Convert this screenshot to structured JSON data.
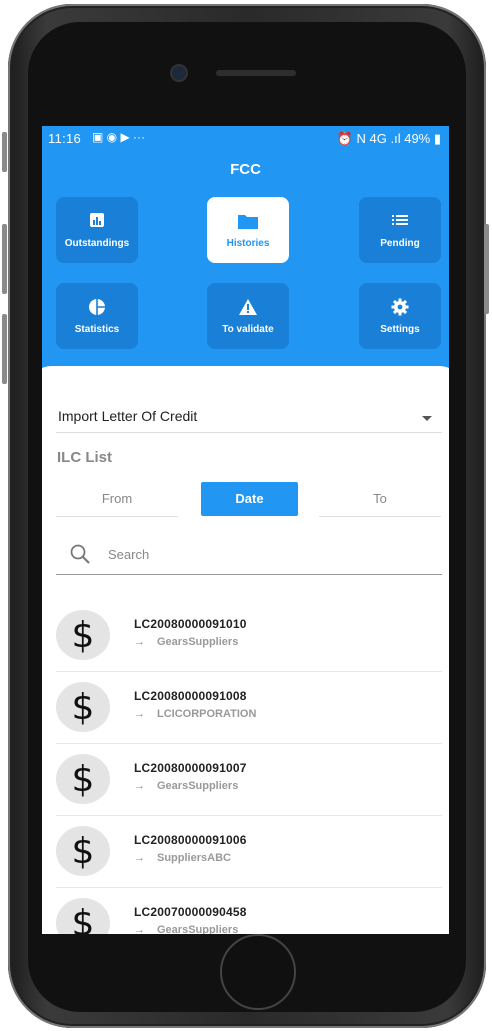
{
  "status_bar": {
    "time": "11:16",
    "left_icons": "▣ ◉ ▶ ···",
    "right_text": "⏰ N 4G .ıl 49% ▮"
  },
  "app": {
    "title": "FCC",
    "accent": "#2196f3"
  },
  "tiles": [
    {
      "label": "Outstandings",
      "icon": "bar-chart-icon",
      "active": false
    },
    {
      "label": "Histories",
      "icon": "folder-icon",
      "active": true
    },
    {
      "label": "Pending",
      "icon": "list-icon",
      "active": false
    },
    {
      "label": "Statistics",
      "icon": "pie-chart-icon",
      "active": false
    },
    {
      "label": "To validate",
      "icon": "warning-icon",
      "active": false
    },
    {
      "label": "Settings",
      "icon": "gear-icon",
      "active": false
    }
  ],
  "dropdown": {
    "value": "Import Letter Of Credit"
  },
  "list_title": "ILC List",
  "segments": {
    "from": "From",
    "date": "Date",
    "to": "To"
  },
  "search": {
    "placeholder": "Search"
  },
  "items": [
    {
      "code": "LC20080000091010",
      "beneficiary": "GearsSuppliers",
      "icon": "dollar-icon"
    },
    {
      "code": "LC20080000091008",
      "beneficiary": "LCICORPORATION",
      "icon": "dollar-icon"
    },
    {
      "code": "LC20080000091007",
      "beneficiary": "GearsSuppliers",
      "icon": "dollar-icon"
    },
    {
      "code": "LC20080000091006",
      "beneficiary": "SuppliersABC",
      "icon": "dollar-icon"
    },
    {
      "code": "LC20070000090458",
      "beneficiary": "GearsSuppliers",
      "icon": "dollar-icon"
    }
  ],
  "glyphs": {
    "dollar": "$",
    "arrow": "→"
  }
}
